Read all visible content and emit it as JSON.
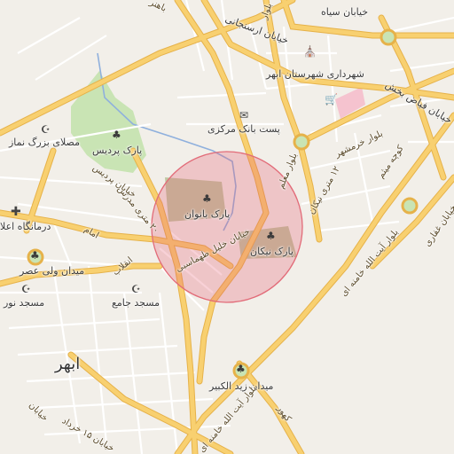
{
  "map": {
    "colors": {
      "background": "#f2efe9",
      "road_major": "#f6c75a",
      "road_major_edge": "#e6b24a",
      "road_minor": "#ffffff",
      "park": "#c9e4b4",
      "water": "#8fb0dd",
      "hospital": "#f5c3cf",
      "circle_fill": "rgba(231,90,110,0.28)",
      "circle_stroke": "#e26b78"
    },
    "labels": {
      "khiaban_siah": "خیابان سیاه",
      "khiaban_arsanjani": "خیابان ارسنجانی",
      "khiaban_fiaz_bakhsh": "خیابان فیاض بخش",
      "shahrdari": "شهرداری شهرستان ابهر",
      "post_bank": "پست بانک مرکزی",
      "bolvar_khorramshahr": "بلوار خرمشهر",
      "koocheh_mitham": "کوچه میثم",
      "mosalla": "مصلای بزرگ نماز",
      "park_pardis": "پارک پردیس",
      "khiaban_pardis": "خیابان پردیس",
      "metri_12": "۱۲ متری نیکان",
      "metri_12b": "۲۰ متری مدرس",
      "park_banovan": "پارک بانوان",
      "park_nikan": "پارک نیکان",
      "khiaban_khalil": "خیابان خلیل طهماسبی",
      "bolvar_ayatollah": "بلوار آیت الله خامنه ای",
      "darmangah": "درمانگاه اعلا",
      "meydan_vali_asr": "میدان ولی عصر",
      "masjed_noor": "مسجد نور",
      "masjed_jame": "مسجد جامع",
      "abhar": "ابهر",
      "meydan_zeid": "میدان زید الکبیر",
      "bolvar_ayatollah2": "بلوار آیت الله خامنه ای",
      "khiaban_khordad": "خیابان ۱۵ خرداد",
      "kohor": "کهور",
      "bolvar_moalem": "بلوار معلم",
      "emam": "امام",
      "khiaban_enghelab": "انقلاب",
      "sepahsalar": "بلوار",
      "road_top_left": "باهنر",
      "khiaban_ghaffari": "خیابان غفاری",
      "khiaban_bottom": "خیابان"
    },
    "icons": {
      "shahrdari_icon": "town-hall-icon",
      "post_icon": "post-office-icon",
      "park_icon": "tree-icon",
      "mosque_icon": "mosque-icon",
      "hospital_icon": "cross-icon",
      "shop_icon": "cart-icon"
    }
  }
}
